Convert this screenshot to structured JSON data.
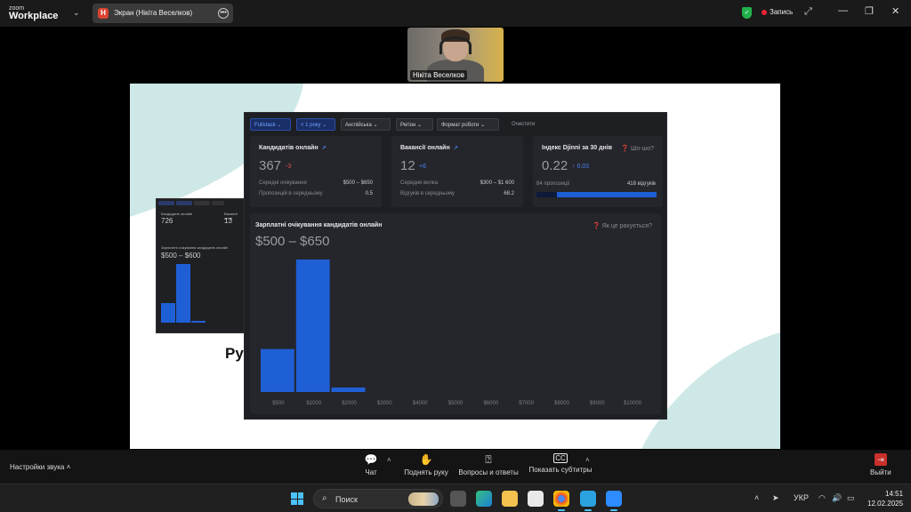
{
  "zoom": {
    "brand_small": "zoom",
    "brand_big": "Workplace",
    "share_badge": "Н",
    "share_label": "Экран (Нікіта Веселков)",
    "rec_label": "Запись",
    "participant_name": "Нікіта Веселков"
  },
  "slide": {
    "peek_text": "Ру"
  },
  "dashboard": {
    "filters": [
      "Fullstack",
      "< 1 року",
      "Англійська",
      "Регіон",
      "Формат роботи",
      "Очистити"
    ],
    "cards": [
      {
        "title": "Кандидатів онлайн",
        "value": "367",
        "delta": "-3",
        "rows": [
          {
            "label": "Середні очікування",
            "value": "$500 – $650"
          },
          {
            "label": "Пропозицій в середньому",
            "value": "0.5"
          }
        ]
      },
      {
        "title": "Вакансії онлайн",
        "value": "12",
        "delta": "+6",
        "rows": [
          {
            "label": "Середня вилка",
            "value": "$300 – $1 600"
          },
          {
            "label": "Відгуків в середньому",
            "value": "68.2"
          }
        ]
      },
      {
        "title": "Індекс Djinni за 30 днів",
        "value": "0.22",
        "delta": "↑ 0.03",
        "help": "Шо-шо?",
        "left_label": "84 пропозиції",
        "right_label": "418 відгуків",
        "progress_fraction": 0.17
      }
    ],
    "chart_title": "Зарплатні очікування кандидатів онлайн",
    "chart_help": "Як це рахується?",
    "chart_range": "$500 – $650"
  },
  "chart_data": {
    "type": "bar",
    "categories": [
      "$500",
      "$1000",
      "$2000",
      "$3000",
      "$4000",
      "$5000",
      "$6000",
      "$7000",
      "$8000",
      "$9000",
      "$10000"
    ],
    "values": [
      48,
      148,
      5,
      0,
      0,
      0,
      0,
      0,
      0,
      0,
      0
    ],
    "title": "Зарплатні очікування кандидатів онлайн",
    "xlabel": "",
    "ylabel": "",
    "grid": false,
    "bar_color": "#1f5fd6"
  },
  "thumbnail": {
    "card1_title": "Кандидатів онлайн",
    "card1_value": "726",
    "card2_title": "Вакансії онла",
    "card2_value": "13",
    "chart_title": "Зарплатні очікування кандидатів онлайн",
    "range": "$500 – $600"
  },
  "controls": {
    "sound_label": "Настройки звука",
    "chat": "Чат",
    "raise_hand": "Поднять руку",
    "qa": "Вопросы и ответы",
    "captions": "Показать субтитры",
    "leave": "Выйти"
  },
  "taskbar": {
    "search_placeholder": "Поиск",
    "lang": "УКР",
    "time": "14:51",
    "date": "12.02.2025"
  }
}
